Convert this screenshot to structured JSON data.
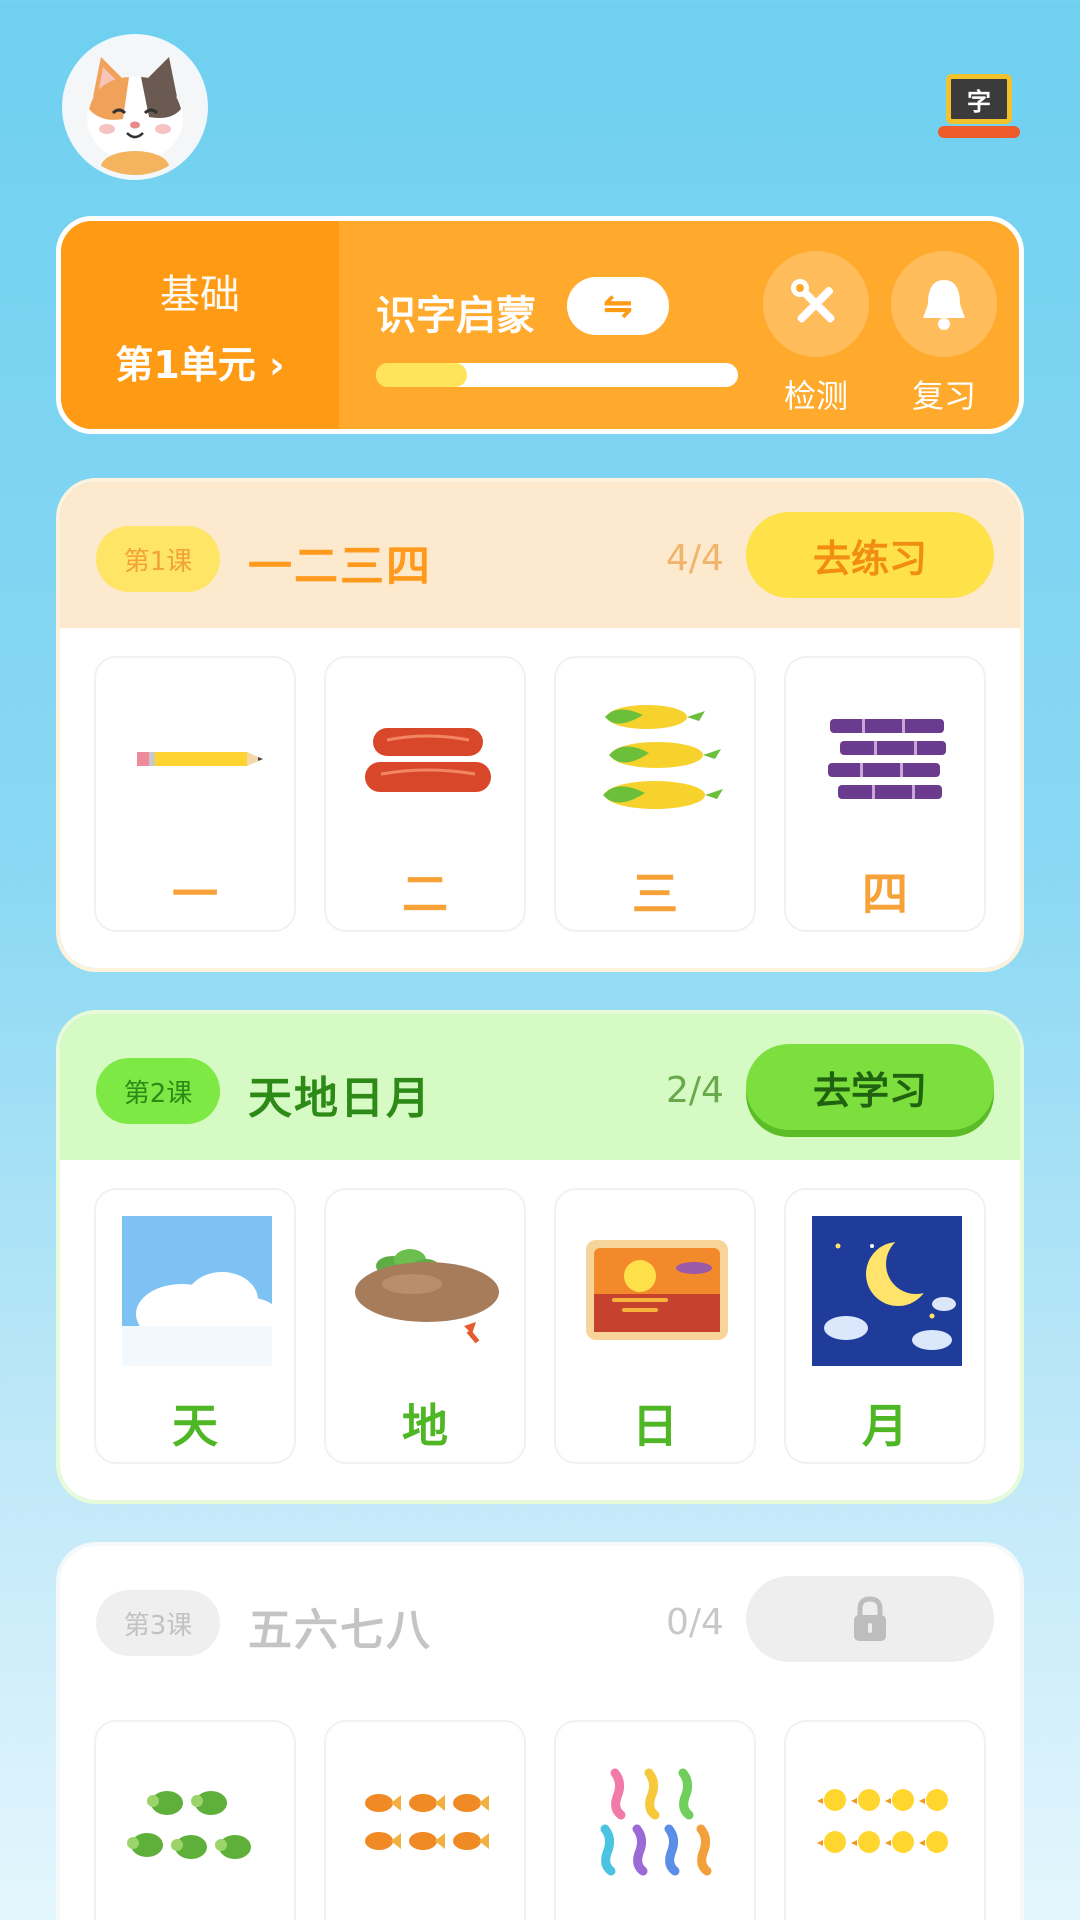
{
  "header": {
    "avatar_icon": "cat-avatar",
    "char_button_label": "字"
  },
  "unit": {
    "level": "基础",
    "name": "第1单元 ›",
    "title": "识字启蒙",
    "swap_symbol": "⇋",
    "progress": 0.25,
    "tools": [
      {
        "label": "检测",
        "icon": "tools-icon"
      },
      {
        "label": "复习",
        "icon": "bell-icon"
      }
    ]
  },
  "lessons": [
    {
      "badge": "第1课",
      "name": "一二三四",
      "count": "4/4",
      "action": "去练习",
      "cards": [
        {
          "char": "一",
          "icon": "pencil-icon"
        },
        {
          "char": "二",
          "icon": "sausages-icon"
        },
        {
          "char": "三",
          "icon": "corn-icon"
        },
        {
          "char": "四",
          "icon": "sugarcane-icon"
        }
      ]
    },
    {
      "badge": "第2课",
      "name": "天地日月",
      "count": "2/4",
      "action": "去学习",
      "cards": [
        {
          "char": "天",
          "icon": "sky-clouds-icon"
        },
        {
          "char": "地",
          "icon": "ground-icon"
        },
        {
          "char": "日",
          "icon": "sunset-icon"
        },
        {
          "char": "月",
          "icon": "moon-night-icon"
        }
      ]
    },
    {
      "badge": "第3课",
      "name": "五六七八",
      "count": "0/4",
      "action_icon": "lock-icon",
      "cards": [
        {
          "icon": "turtles-icon"
        },
        {
          "icon": "goldfish-icon"
        },
        {
          "icon": "seahorses-icon"
        },
        {
          "icon": "ducklings-icon"
        }
      ]
    }
  ]
}
